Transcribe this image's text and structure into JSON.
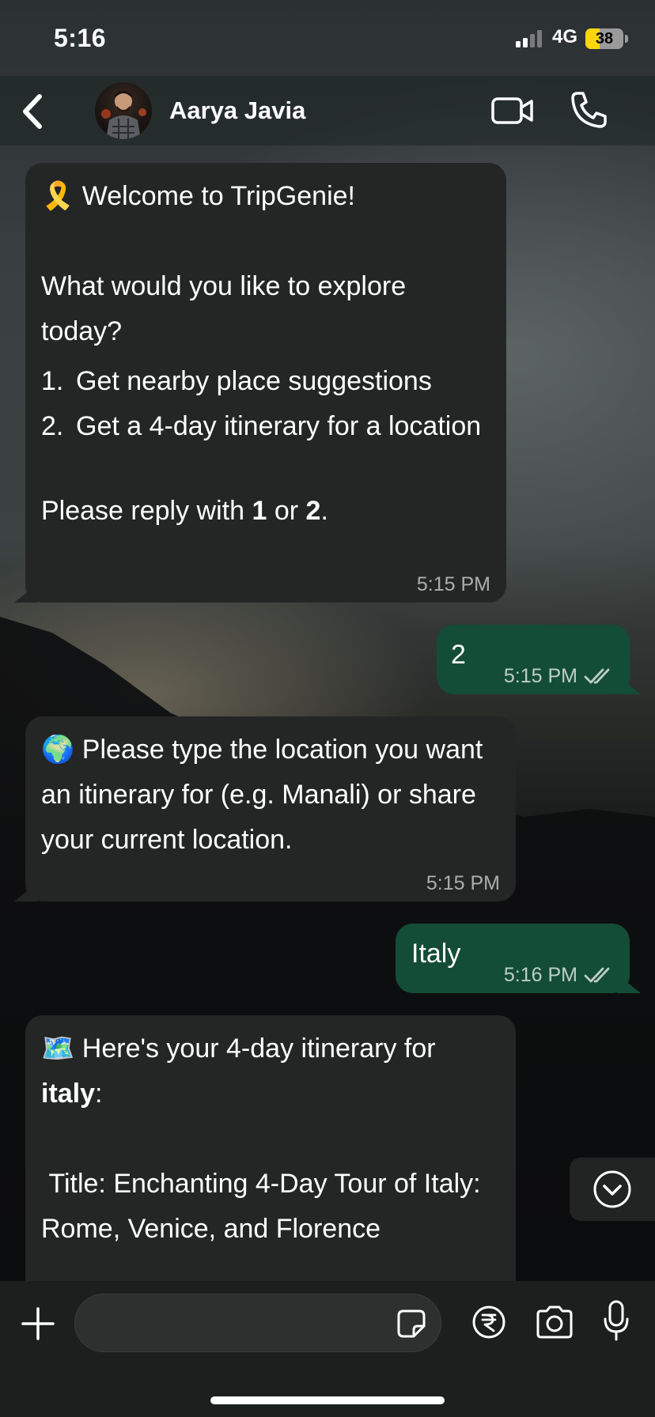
{
  "status_bar": {
    "time": "5:16",
    "network": "4G",
    "battery": "38",
    "battery_level": 0.38
  },
  "header": {
    "contact_name": "Aarya Javia"
  },
  "messages": [
    {
      "direction": "incoming",
      "emoji": "🎗️",
      "title": "Welcome to TripGenie!",
      "question": "What would you like to explore today?",
      "options": [
        {
          "num": "1.",
          "text": "Get nearby place suggestions"
        },
        {
          "num": "2.",
          "text": "Get a 4-day itinerary for a location"
        }
      ],
      "reply_prefix": "Please reply with ",
      "reply_opt1": "1",
      "reply_or": " or ",
      "reply_opt2": "2",
      "reply_suffix": ".",
      "time": "5:15 PM"
    },
    {
      "direction": "outgoing",
      "text": "2",
      "time": "5:15 PM",
      "status": "read"
    },
    {
      "direction": "incoming",
      "emoji": "🌍",
      "text": "Please type the location you want an itinerary for (e.g. Manali) or share your current location.",
      "time": "5:15 PM"
    },
    {
      "direction": "outgoing",
      "text": "Italy",
      "time": "5:16 PM",
      "status": "read"
    },
    {
      "direction": "incoming",
      "emoji": "🗺️",
      "intro": "Here's your 4-day itinerary for ",
      "place": "italy",
      "colon": ":",
      "body": " Title: Enchanting 4-Day Tour of Italy: Rome, Venice, and Florence"
    }
  ],
  "composer": {
    "placeholder": ""
  },
  "colors": {
    "incoming_bubble": "#242626",
    "outgoing_bubble": "#144d37",
    "header_bg": "#1c2422",
    "composer_bg": "#1d1f1f"
  },
  "icons": {
    "back": "chevron-left-icon",
    "video": "video-camera-icon",
    "call": "phone-icon",
    "scroll": "chevron-down-circle-icon",
    "plus": "plus-icon",
    "sticker": "sticker-icon",
    "payment": "rupee-icon",
    "camera": "camera-icon",
    "mic": "microphone-icon"
  }
}
